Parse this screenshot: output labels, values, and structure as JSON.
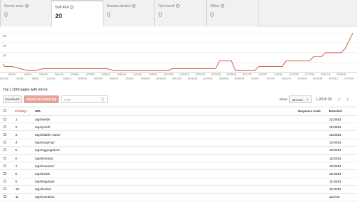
{
  "tabs": [
    {
      "label": "Server error",
      "count": "0",
      "active": false
    },
    {
      "label": "Soft 404",
      "count": "20",
      "active": true
    },
    {
      "label": "Access denied",
      "count": "0",
      "active": false
    },
    {
      "label": "Not found",
      "count": "0",
      "active": false
    },
    {
      "label": "Other",
      "count": "0",
      "active": false
    }
  ],
  "chart_data": {
    "type": "line",
    "color": "#d14836",
    "y_ticks": [
      "20",
      "15",
      "10",
      "5"
    ],
    "ylim": [
      0,
      22
    ],
    "x_labels_row1": [
      "9/2/15",
      "9/6/15",
      "9/10/15",
      "9/14/15",
      "9/18/15",
      "9/22/15",
      "9/26/15",
      "9/30/15",
      "10/4/15",
      "10/8/15",
      "10/12/15",
      "10/16/15",
      "10/20/15",
      "10/24/15",
      "10/28/15",
      "11/1/15",
      "11/5/15",
      "11/9/15",
      "11/13/15",
      "11/17/15",
      "11/21/15",
      "11/25/15"
    ],
    "x_labels_row2": [
      "8/31/15",
      "9/4/15",
      "9/8/15",
      "9/12/15",
      "9/16/15",
      "9/20/15",
      "9/24/15",
      "9/28/15",
      "10/2/15",
      "10/6/15",
      "10/10/15",
      "10/14/15",
      "10/18/15",
      "10/22/15",
      "10/26/15",
      "10/30/15",
      "11/3/15",
      "11/7/15",
      "11/11/15",
      "11/15/15",
      "11/19/15",
      "11/23/15",
      "11/27/15"
    ],
    "points": [
      {
        "x": "8/31/15",
        "y": 3
      },
      {
        "x": "9/2/15",
        "y": 3
      },
      {
        "x": "9/4/15",
        "y": 2
      },
      {
        "x": "9/6/15",
        "y": 1
      },
      {
        "x": "9/8/15",
        "y": 1
      },
      {
        "x": "9/10/15",
        "y": 2
      },
      {
        "x": "9/26/15",
        "y": 2
      },
      {
        "x": "9/28/15",
        "y": 1
      },
      {
        "x": "10/12/15",
        "y": 1
      },
      {
        "x": "10/13/15",
        "y": 2
      },
      {
        "x": "10/24/15",
        "y": 2
      },
      {
        "x": "10/25/15",
        "y": 6
      },
      {
        "x": "10/28/15",
        "y": 6
      },
      {
        "x": "10/29/15",
        "y": 1
      },
      {
        "x": "11/3/15",
        "y": 1
      },
      {
        "x": "11/4/15",
        "y": 3
      },
      {
        "x": "11/10/15",
        "y": 3
      },
      {
        "x": "11/11/15",
        "y": 6
      },
      {
        "x": "11/17/15",
        "y": 6
      },
      {
        "x": "11/18/15",
        "y": 8
      },
      {
        "x": "11/20/15",
        "y": 8
      },
      {
        "x": "11/21/15",
        "y": 10
      },
      {
        "x": "11/25/15",
        "y": 10
      },
      {
        "x": "11/26/15",
        "y": 12
      },
      {
        "x": "11/28/15",
        "y": 20
      }
    ]
  },
  "list": {
    "title": "Top 1,000 pages with errors",
    "download_label": "Download",
    "mark_fixed_label": "MARK AS FIXED (0)",
    "filter_placeholder": "Filter",
    "show_label": "Show",
    "rows_value": "25 rows",
    "range_text": "1-20 of 20",
    "prev": "‹",
    "next": "›"
  },
  "table": {
    "headers": {
      "priority": "Priority",
      "url": "URL",
      "response_code": "Response Code",
      "detected": "Detected"
    },
    "rows": [
      {
        "priority": "1",
        "url": "tags/weibi/",
        "detected": "11/29/15"
      },
      {
        "priority": "2",
        "url": "tags/pirelli/",
        "detected": "11/28/15"
      },
      {
        "priority": "3",
        "url": "tags/diablo-rosso/",
        "detected": "11/28/15"
      },
      {
        "priority": "4",
        "url": "tags/angel-gt/",
        "detected": "11/26/15"
      },
      {
        "priority": "5",
        "url": "tags/aggregation/",
        "detected": "11/20/15"
      },
      {
        "priority": "6",
        "url": "tags/lending/",
        "detected": "11/20/15"
      },
      {
        "priority": "7",
        "url": "tags/member/",
        "detected": "11/20/15"
      },
      {
        "priority": "8",
        "url": "tags/2016/",
        "detected": "11/18/15"
      },
      {
        "priority": "9",
        "url": "tags/leggings/",
        "detected": "11/18/15"
      },
      {
        "priority": "10",
        "url": "tags/lexlan/",
        "detected": "11/15/15"
      },
      {
        "priority": "11",
        "url": "tags/yamaha/",
        "detected": "11/2/15"
      }
    ]
  }
}
